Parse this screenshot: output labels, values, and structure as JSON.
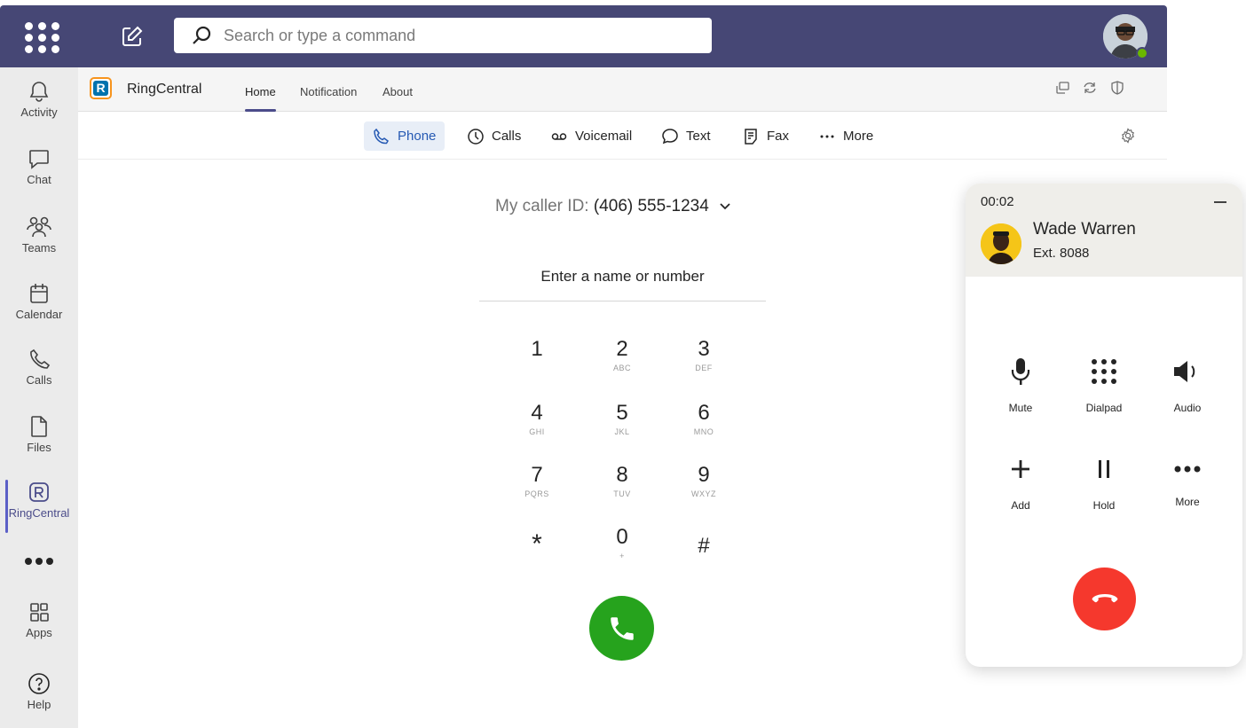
{
  "topbar": {
    "search_placeholder": "Search or type a command",
    "icons": [
      "app-launcher-icon",
      "compose-icon",
      "search-icon"
    ],
    "presence_color": "#6bb700"
  },
  "rail": {
    "items": [
      {
        "label": "Activity",
        "icon": "bell-icon"
      },
      {
        "label": "Chat",
        "icon": "chat-icon"
      },
      {
        "label": "Teams",
        "icon": "teams-icon"
      },
      {
        "label": "Calendar",
        "icon": "calendar-icon"
      },
      {
        "label": "Calls",
        "icon": "phone-icon"
      },
      {
        "label": "Files",
        "icon": "file-icon"
      },
      {
        "label": "RingCentral",
        "icon": "ringcentral-icon"
      },
      {
        "label": "",
        "icon": "more-icon"
      },
      {
        "label": "Apps",
        "icon": "apps-icon"
      },
      {
        "label": "Help",
        "icon": "help-icon"
      }
    ],
    "active": "RingCentral",
    "accent": "#5b5fc7"
  },
  "app_header": {
    "app_name": "RingCentral",
    "logo_letter": "R",
    "tabs": [
      "Home",
      "Notification",
      "About"
    ],
    "active_tab": "Home",
    "brand_colors": {
      "orange": "#f7941d",
      "blue": "#0073ae"
    }
  },
  "subnav": {
    "tabs": [
      {
        "label": "Phone",
        "icon": "phone-icon"
      },
      {
        "label": "Calls",
        "icon": "clock-icon"
      },
      {
        "label": "Voicemail",
        "icon": "voicemail-icon"
      },
      {
        "label": "Text",
        "icon": "message-icon"
      },
      {
        "label": "Fax",
        "icon": "fax-icon"
      },
      {
        "label": "More",
        "icon": "more-icon"
      }
    ],
    "active_tab": "Phone"
  },
  "dialer": {
    "caller_id_label": "My caller ID:",
    "caller_id_number": "(406) 555-1234",
    "input_placeholder": "Enter a name or number",
    "keys": [
      {
        "digit": "1",
        "letters": ""
      },
      {
        "digit": "2",
        "letters": "ABC"
      },
      {
        "digit": "3",
        "letters": "DEF"
      },
      {
        "digit": "4",
        "letters": "GHI"
      },
      {
        "digit": "5",
        "letters": "JKL"
      },
      {
        "digit": "6",
        "letters": "MNO"
      },
      {
        "digit": "7",
        "letters": "PQRS"
      },
      {
        "digit": "8",
        "letters": "TUV"
      },
      {
        "digit": "9",
        "letters": "WXYZ"
      },
      {
        "digit": "*",
        "letters": ""
      },
      {
        "digit": "0",
        "letters": "+"
      },
      {
        "digit": "#",
        "letters": ""
      }
    ],
    "call_button_color": "#26a31d"
  },
  "call_panel": {
    "timer": "00:02",
    "contact_name": "Wade Warren",
    "extension": "Ext. 8088",
    "controls": [
      {
        "label": "Mute",
        "icon": "microphone-icon"
      },
      {
        "label": "Dialpad",
        "icon": "dialpad-icon"
      },
      {
        "label": "Audio",
        "icon": "speaker-icon"
      },
      {
        "label": "Add",
        "icon": "plus-icon"
      },
      {
        "label": "Hold",
        "icon": "pause-icon"
      },
      {
        "label": "More",
        "icon": "more-icon"
      }
    ],
    "hangup_color": "#f5382d"
  }
}
